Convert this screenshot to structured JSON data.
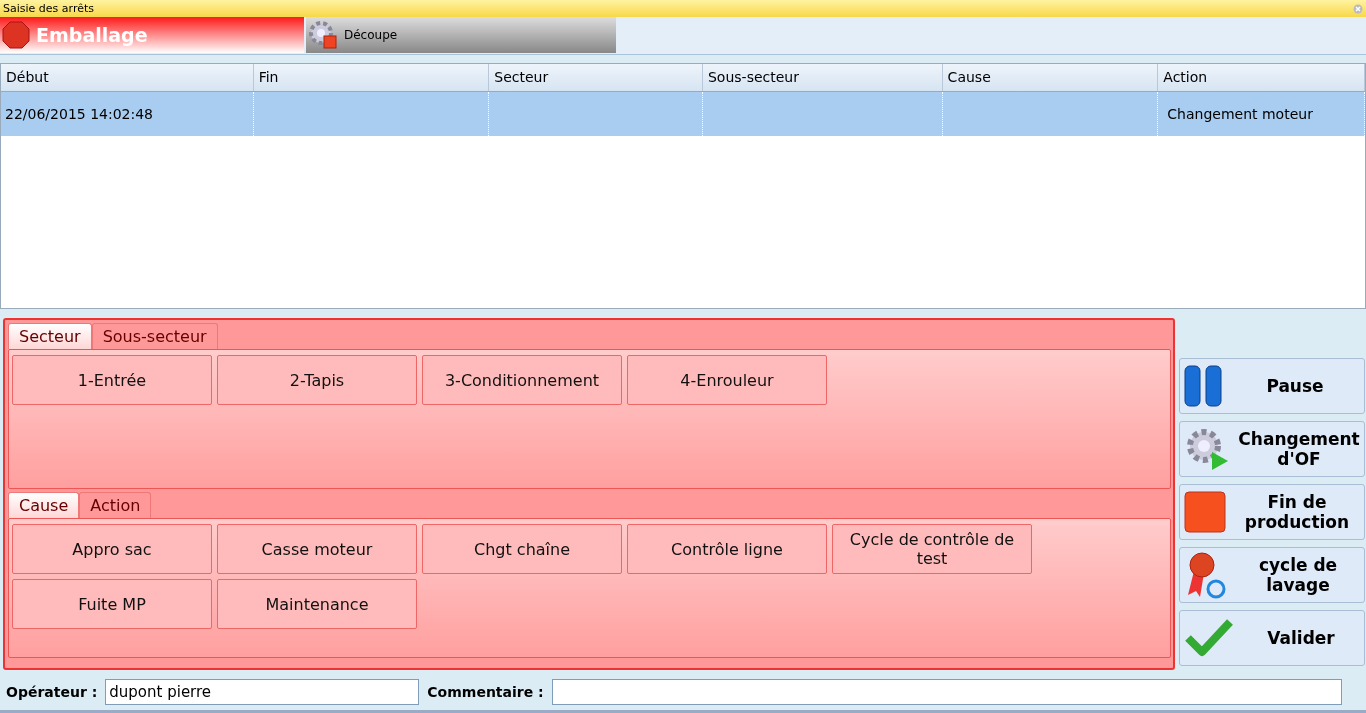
{
  "window": {
    "title": "Saisie des arrêts"
  },
  "lines": [
    {
      "label": "Emballage",
      "selected": true,
      "kind": "stop"
    },
    {
      "label": "Découpe",
      "selected": false,
      "kind": "gear"
    }
  ],
  "table": {
    "columns": [
      "Début",
      "Fin",
      "Secteur",
      "Sous-secteur",
      "Cause",
      "Action"
    ],
    "rows": [
      {
        "selected": true,
        "cells": [
          "22/06/2015 14:02:48",
          "",
          "",
          "",
          "",
          "Changement moteur"
        ]
      }
    ]
  },
  "sector_panel": {
    "tabs": [
      {
        "label": "Secteur",
        "selected": true
      },
      {
        "label": "Sous-secteur",
        "selected": false
      }
    ],
    "buttons": [
      "1-Entrée",
      "2-Tapis",
      "3-Conditionnement",
      "4-Enrouleur"
    ]
  },
  "cause_panel": {
    "tabs": [
      {
        "label": "Cause",
        "selected": true
      },
      {
        "label": "Action",
        "selected": false
      }
    ],
    "buttons": [
      "Appro sac",
      "Casse moteur",
      "Chgt chaîne",
      "Contrôle ligne",
      "Cycle de contrôle de test",
      "Fuite MP",
      "Maintenance"
    ]
  },
  "actions": [
    {
      "label": "Pause",
      "kind": "pause"
    },
    {
      "label": "Changement d'OF",
      "kind": "gear-play"
    },
    {
      "label": "Fin de production",
      "kind": "stop-square"
    },
    {
      "label": "cycle de lavage",
      "kind": "ribbon"
    },
    {
      "label": "Valider",
      "kind": "check"
    }
  ],
  "footer": {
    "operator_label": "Opérateur :",
    "operator_value": "dupont pierre",
    "comment_label": "Commentaire :"
  }
}
